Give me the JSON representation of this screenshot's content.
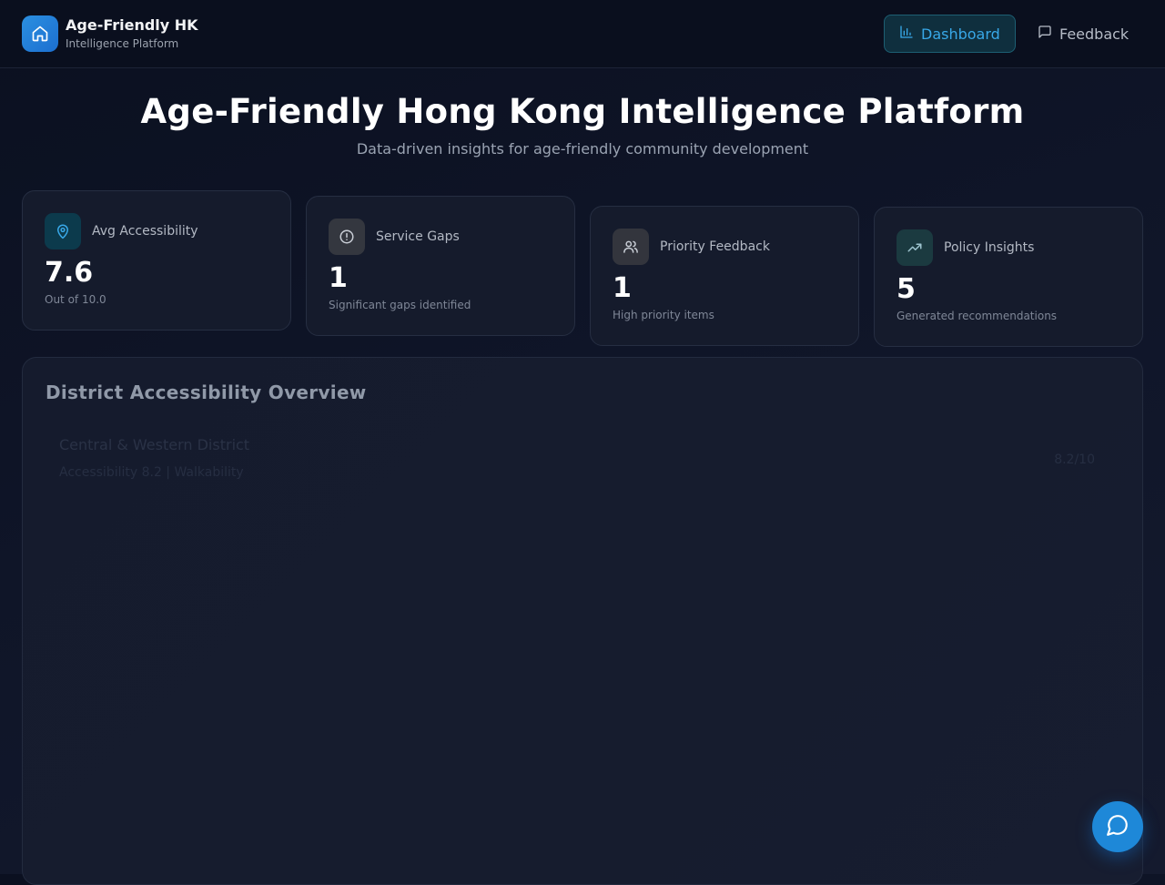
{
  "header": {
    "brand_name": "Age-Friendly HK",
    "brand_subtitle": "Intelligence Platform",
    "nav": [
      {
        "label": "Dashboard",
        "icon": "bar-chart-icon",
        "active": true
      },
      {
        "label": "Feedback",
        "icon": "message-square-icon",
        "active": false
      }
    ]
  },
  "hero": {
    "title": "Age-Friendly Hong Kong Intelligence Platform",
    "subtitle": "Data-driven insights for age-friendly community development"
  },
  "stats": [
    {
      "label": "Avg Accessibility",
      "value": "7.6",
      "note": "Out of 10.0",
      "icon": "map-pin-icon",
      "accent": "#38a8e8"
    },
    {
      "label": "Service Gaps",
      "value": "1",
      "note": "Significant gaps identified",
      "icon": "alert-circle-icon",
      "accent": "#9aa3b2"
    },
    {
      "label": "Priority Feedback",
      "value": "1",
      "note": "High priority items",
      "icon": "users-icon",
      "accent": "#9aa3b2"
    },
    {
      "label": "Policy Insights",
      "value": "5",
      "note": "Generated recommendations",
      "icon": "trending-up-icon",
      "accent": "#7fb5c4"
    }
  ],
  "overview": {
    "title": "District Accessibility Overview",
    "districts": [
      {
        "name": "Central & Western District",
        "meta": "Accessibility 8.2 | Walkability",
        "score": "8.2/10"
      }
    ]
  },
  "colors": {
    "accent": "#1e88d8",
    "background": "#0f1528",
    "card": "#151b2c"
  }
}
